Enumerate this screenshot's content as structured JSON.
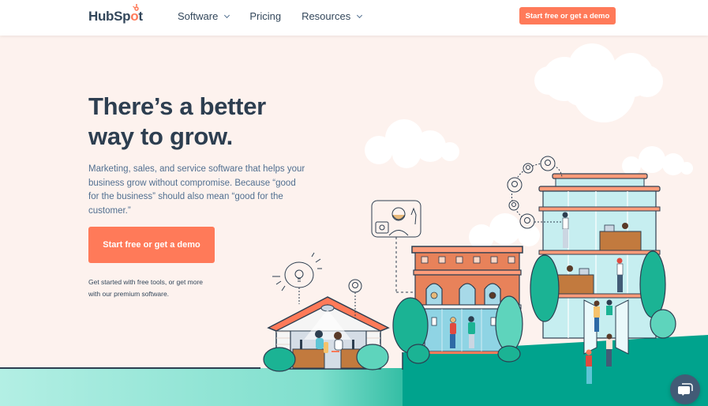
{
  "header": {
    "logo_text_a": "HubSp",
    "logo_text_o": "o",
    "logo_text_b": "t",
    "nav": [
      {
        "label": "Software",
        "has_dropdown": true
      },
      {
        "label": "Pricing",
        "has_dropdown": false
      },
      {
        "label": "Resources",
        "has_dropdown": true
      }
    ],
    "cta_label": "Start free or get a demo"
  },
  "hero": {
    "title_line1": "There’s a better",
    "title_line2": "way to grow.",
    "subtitle": "Marketing, sales, and service software that helps your business grow without compromise. Because “good for the business” should also mean “good for the customer.”",
    "cta_label": "Start free or get a demo",
    "note": "Get started with free tools, or get more with our premium software."
  },
  "illustration": {
    "description": "Growing town illustration: small house, brick shop and glass office building with people, trees, clouds and avatar bubbles",
    "colors": {
      "background": "#fdf2ee",
      "ground": "#00a38d",
      "ground_light": "#a9ebdd",
      "accent": "#ff7a59",
      "ink": "#2d3e50",
      "glass": "#c6eef0",
      "brick": "#e8825a",
      "tree": "#1bb394",
      "tree_light": "#5ed4bc",
      "wood": "#c27a3e"
    }
  },
  "chat_widget": {
    "icon": "chat-bubbles-icon",
    "color": "#425b76"
  }
}
